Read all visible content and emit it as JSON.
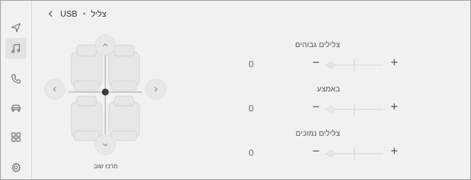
{
  "header": {
    "title": "צליל",
    "separator": "•",
    "source": "USB"
  },
  "sidebar": {
    "items": [
      {
        "icon": "navigation-icon"
      },
      {
        "icon": "music-icon",
        "active": true
      },
      {
        "icon": "phone-icon"
      },
      {
        "icon": "car-icon"
      },
      {
        "icon": "apps-icon"
      },
      {
        "icon": "settings-icon"
      }
    ]
  },
  "seat_panel": {
    "center_label": "מרכז שוב"
  },
  "controls": [
    {
      "label": "צלילים גבוהים",
      "value": "0",
      "level": 0
    },
    {
      "label": "באמצע",
      "value": "0",
      "level": 0
    },
    {
      "label": "צלילים נמוכים",
      "value": "0",
      "level": 0
    }
  ],
  "symbols": {
    "minus": "−",
    "plus": "+"
  },
  "colors": {
    "background": "#f1f1f1",
    "active_item": "#e2e2e2",
    "seat": "#e6e6e6"
  }
}
